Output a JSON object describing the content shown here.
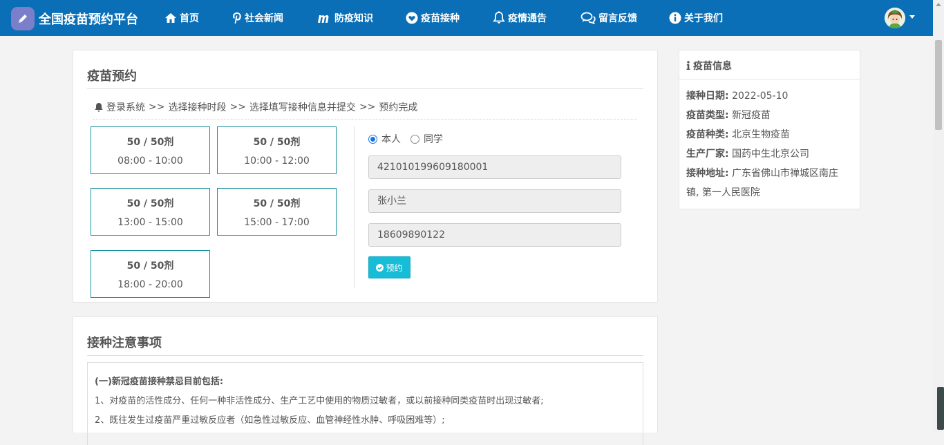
{
  "nav": {
    "brand": "全国疫苗预约平台",
    "items": [
      {
        "label": "首页",
        "icon": "home-icon"
      },
      {
        "label": "社会新闻",
        "icon": "pinterest-icon"
      },
      {
        "label": "防疫知识",
        "icon": "m-logo-icon"
      },
      {
        "label": "疫苗接种",
        "icon": "heart-icon"
      },
      {
        "label": "疫情通告",
        "icon": "bell-icon"
      },
      {
        "label": "留言反馈",
        "icon": "comments-icon"
      },
      {
        "label": "关于我们",
        "icon": "info-icon"
      }
    ]
  },
  "booking": {
    "title": "疫苗预约",
    "steps": [
      "登录系统",
      "选择接种时段",
      "选择填写接种信息并提交",
      "预约完成"
    ],
    "step_sep": ">>",
    "slots": [
      {
        "count": "50 / 50剂",
        "time": "08:00 - 10:00"
      },
      {
        "count": "50 / 50剂",
        "time": "10:00 - 12:00"
      },
      {
        "count": "50 / 50剂",
        "time": "13:00 - 15:00"
      },
      {
        "count": "50 / 50剂",
        "time": "15:00 - 17:00"
      },
      {
        "count": "50 / 50剂",
        "time": "18:00 - 20:00"
      }
    ],
    "radio_self": "本人",
    "radio_classmate": "同学",
    "id_number": "421010199609180001",
    "name": "张小兰",
    "phone": "18609890122",
    "submit_label": "预约"
  },
  "vaccine_info": {
    "title": "疫苗信息",
    "rows": [
      {
        "label": "接种日期:",
        "value": "2022-05-10"
      },
      {
        "label": "疫苗类型:",
        "value": "新冠疫苗"
      },
      {
        "label": "疫苗种类:",
        "value": "北京生物疫苗"
      },
      {
        "label": "生产厂家:",
        "value": "国药中生北京公司"
      },
      {
        "label": "接种地址:",
        "value": "广东省佛山市禅城区南庄"
      }
    ],
    "address_cont": "镇, 第一人民医院"
  },
  "notice": {
    "title": "接种注意事项",
    "heading": "(一)新冠疫苗接种禁忌目前包括:",
    "lines": [
      "1、对疫苗的活性成分、任何一种非活性成分、生产工艺中使用的物质过敏者，或以前接种同类疫苗时出现过敏者;",
      "2、既往发生过疫苗严重过敏反应者（如急性过敏反应、血管神经性水肿、呼吸困难等）;"
    ]
  }
}
